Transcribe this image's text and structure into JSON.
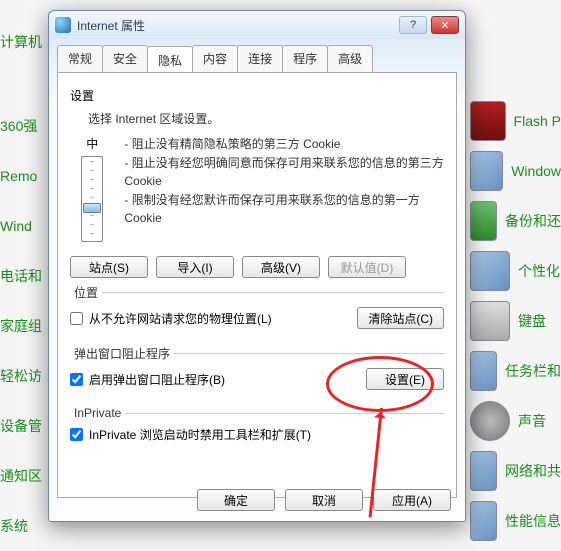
{
  "bg_left": [
    "计算机",
    "360强",
    "Remo",
    "Wind",
    "电话和",
    "家庭组",
    "轻松访",
    "设备管",
    "通知区",
    "系统"
  ],
  "bg_right": [
    "Flash P",
    "Window",
    "备份和还",
    "个性化",
    "键盘",
    "任务栏和",
    "声音",
    "网络和共",
    "性能信息"
  ],
  "dialog": {
    "title": "Internet 属性",
    "help": "?",
    "close": "✕",
    "tabs": [
      "常规",
      "安全",
      "隐私",
      "内容",
      "连接",
      "程序",
      "高级"
    ],
    "active_tab": 2,
    "settings": {
      "heading": "设置",
      "desc": "选择 Internet 区域设置。",
      "level": "中",
      "bullets": [
        "阻止没有精简隐私策略的第三方 Cookie",
        "阻止没有经您明确同意而保存可用来联系您的信息的第三方 Cookie",
        "限制没有经您默许而保存可用来联系您的信息的第一方 Cookie"
      ],
      "btn_sites": "站点(S)",
      "btn_import": "导入(I)",
      "btn_advanced": "高级(V)",
      "btn_default": "默认值(D)"
    },
    "location": {
      "legend": "位置",
      "checkbox": "从不允许网站请求您的物理位置(L)",
      "checked": false,
      "btn_clear": "清除站点(C)"
    },
    "popup": {
      "legend": "弹出窗口阻止程序",
      "checkbox": "启用弹出窗口阻止程序(B)",
      "checked": true,
      "btn_settings": "设置(E)"
    },
    "inprivate": {
      "legend": "InPrivate",
      "checkbox": "InPrivate 浏览启动时禁用工具栏和扩展(T)",
      "checked": true
    },
    "footer": {
      "ok": "确定",
      "cancel": "取消",
      "apply": "应用(A)"
    }
  }
}
